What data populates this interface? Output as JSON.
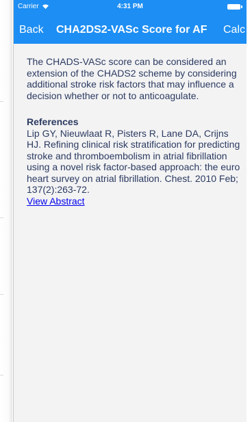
{
  "status_bar": {
    "carrier": "Carrier",
    "time": "4:31 PM",
    "wifi_icon": "wifi-icon",
    "battery_icon": "battery-icon"
  },
  "nav": {
    "back_label": "Back",
    "title": "CHA2DS2-VASc Score for AF",
    "calc_label": "Calc"
  },
  "content": {
    "intro": "The CHADS-VASc score can be considered an extension of the CHADS2 scheme by considering additional stroke risk factors that may influence a decision whether or not to anticoagulate.",
    "references_heading": "References",
    "reference_text": "Lip GY, Nieuwlaat R, Pisters R, Lane DA, Crijns HJ. Refining clinical risk stratification for predicting stroke and thromboembolism in atrial fibrillation using a novel risk factor-based approach: the euro heart survey on atrial fibrillation. Chest. 2010 Feb; 137(2):263-72.",
    "view_abstract_label": "View Abstract"
  },
  "colors": {
    "nav_background": "#1d8ef3",
    "body_text": "#2b3a60",
    "link": "#0000ee",
    "page_background": "#f3f3f4"
  }
}
